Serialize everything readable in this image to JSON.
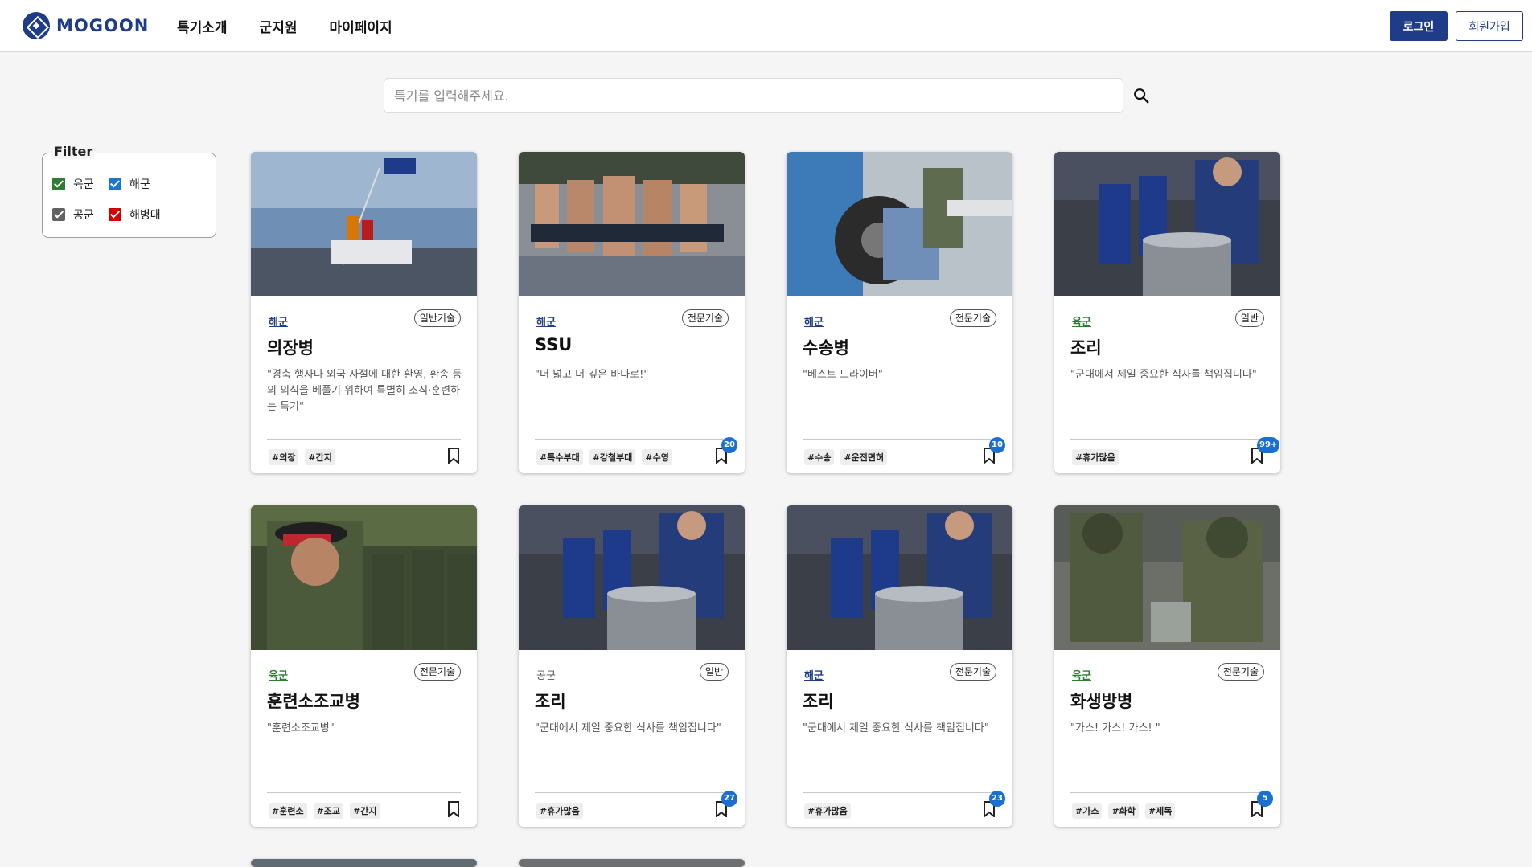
{
  "header": {
    "logo_text": "MOGOON",
    "nav": [
      "특기소개",
      "군지원",
      "마이페이지"
    ],
    "login_label": "로그인",
    "signup_label": "회원가입"
  },
  "search": {
    "placeholder": "특기를 입력해주세요.",
    "value": ""
  },
  "filter": {
    "legend": "Filter",
    "options": [
      {
        "label": "육군",
        "checked": true,
        "color": "#2e7d32"
      },
      {
        "label": "해군",
        "checked": true,
        "color": "#1976d2"
      },
      {
        "label": "공군",
        "checked": true,
        "color": "#616161"
      },
      {
        "label": "해병대",
        "checked": true,
        "color": "#d50000"
      }
    ]
  },
  "colors": {
    "brand": "#1f3c88",
    "army": "#2e7d32",
    "navy": "#1f3c88",
    "airforce": "#555555",
    "badge": "#1a6fd1"
  },
  "cards": [
    {
      "branch": "해군",
      "category": "일반기술",
      "title": "의장병",
      "desc": "\"경축 행사나 외국 사절에 대한 환영, 환송 등의 의식을 베풀기 위하여 특별히 조직·훈련하는 특기\"",
      "tags": [
        "#의장",
        "#간지"
      ],
      "count": "",
      "image": "ship-ceremony-photo"
    },
    {
      "branch": "해군",
      "category": "전문기술",
      "title": "SSU",
      "desc": "\"더 넓고 더 깊은 바다로!\"",
      "tags": [
        "#특수부대",
        "#강철부대",
        "#수영"
      ],
      "count": "20",
      "image": "running-soldiers-photo"
    },
    {
      "branch": "해군",
      "category": "전문기술",
      "title": "수송병",
      "desc": "\"베스트 드라이버\"",
      "tags": [
        "#수송",
        "#운전면허"
      ],
      "count": "10",
      "image": "tire-change-photo"
    },
    {
      "branch": "육군",
      "category": "일반",
      "title": "조리",
      "desc": "\"군대에서 제일 중요한 식사를 책임집니다\"",
      "tags": [
        "#휴가많음"
      ],
      "count": "99+",
      "image": "military-cook-photo"
    },
    {
      "branch": "육군",
      "category": "전문기술",
      "title": "훈련소조교병",
      "desc": "\"훈련소조교병\"",
      "tags": [
        "#훈련소",
        "#조교",
        "#간지"
      ],
      "count": "",
      "image": "drill-instructor-photo"
    },
    {
      "branch": "공군",
      "category": "일반",
      "title": "조리",
      "desc": "\"군대에서 제일 중요한 식사를 책임집니다\"",
      "tags": [
        "#휴가많음"
      ],
      "count": "27",
      "image": "military-cook-photo"
    },
    {
      "branch": "해군",
      "category": "전문기술",
      "title": "조리",
      "desc": "\"군대에서 제일 중요한 식사를 책임집니다\"",
      "tags": [
        "#휴가많음"
      ],
      "count": "23",
      "image": "military-cook-photo"
    },
    {
      "branch": "육군",
      "category": "전문기술",
      "title": "화생방병",
      "desc": "\"가스! 가스! 가스! \"",
      "tags": [
        "#가스",
        "#화학",
        "#제독"
      ],
      "count": "5",
      "image": "chemical-suit-photo"
    }
  ]
}
